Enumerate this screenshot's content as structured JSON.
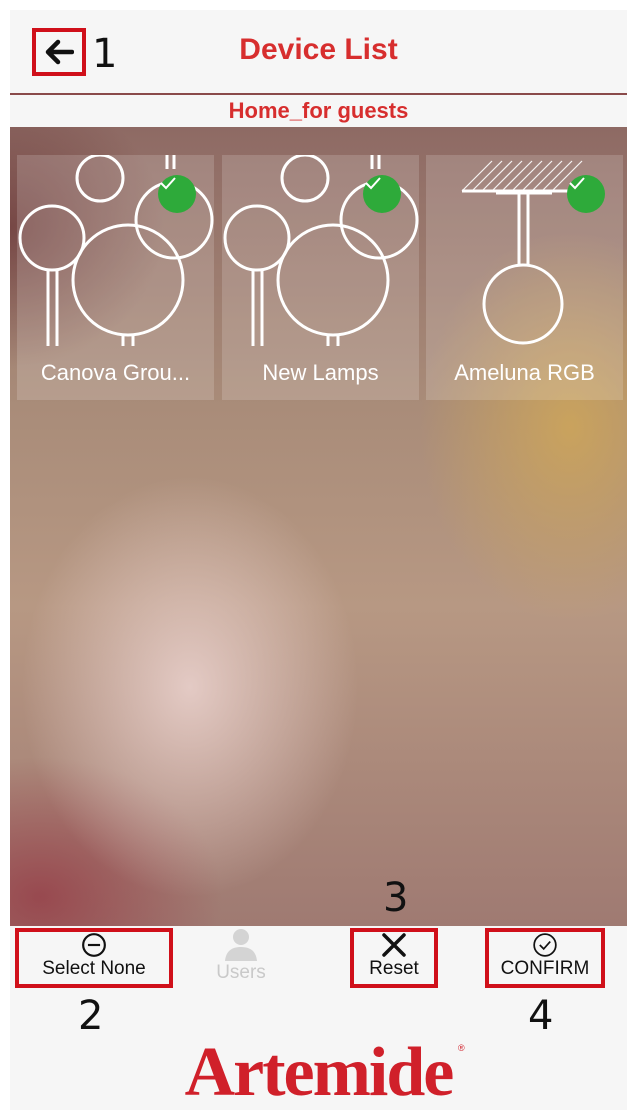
{
  "header": {
    "title": "Device List",
    "subtitle": "Home_for guests"
  },
  "annotations": [
    "1",
    "2",
    "3",
    "4"
  ],
  "devices": [
    {
      "label": "Canova Grou...",
      "icon": "canova-lamp-icon",
      "selected": true
    },
    {
      "label": "New Lamps",
      "icon": "canova-lamp-icon",
      "selected": true
    },
    {
      "label": "Ameluna RGB",
      "icon": "ameluna-lamp-icon",
      "selected": true
    }
  ],
  "toolbar": {
    "select_none": "Select None",
    "users": "Users",
    "reset": "Reset",
    "confirm": "CONFIRM"
  },
  "brand": "Artemide",
  "colors": {
    "accent": "#d72e2e",
    "highlight_box": "#d0101a",
    "check": "#2eaa3a"
  }
}
